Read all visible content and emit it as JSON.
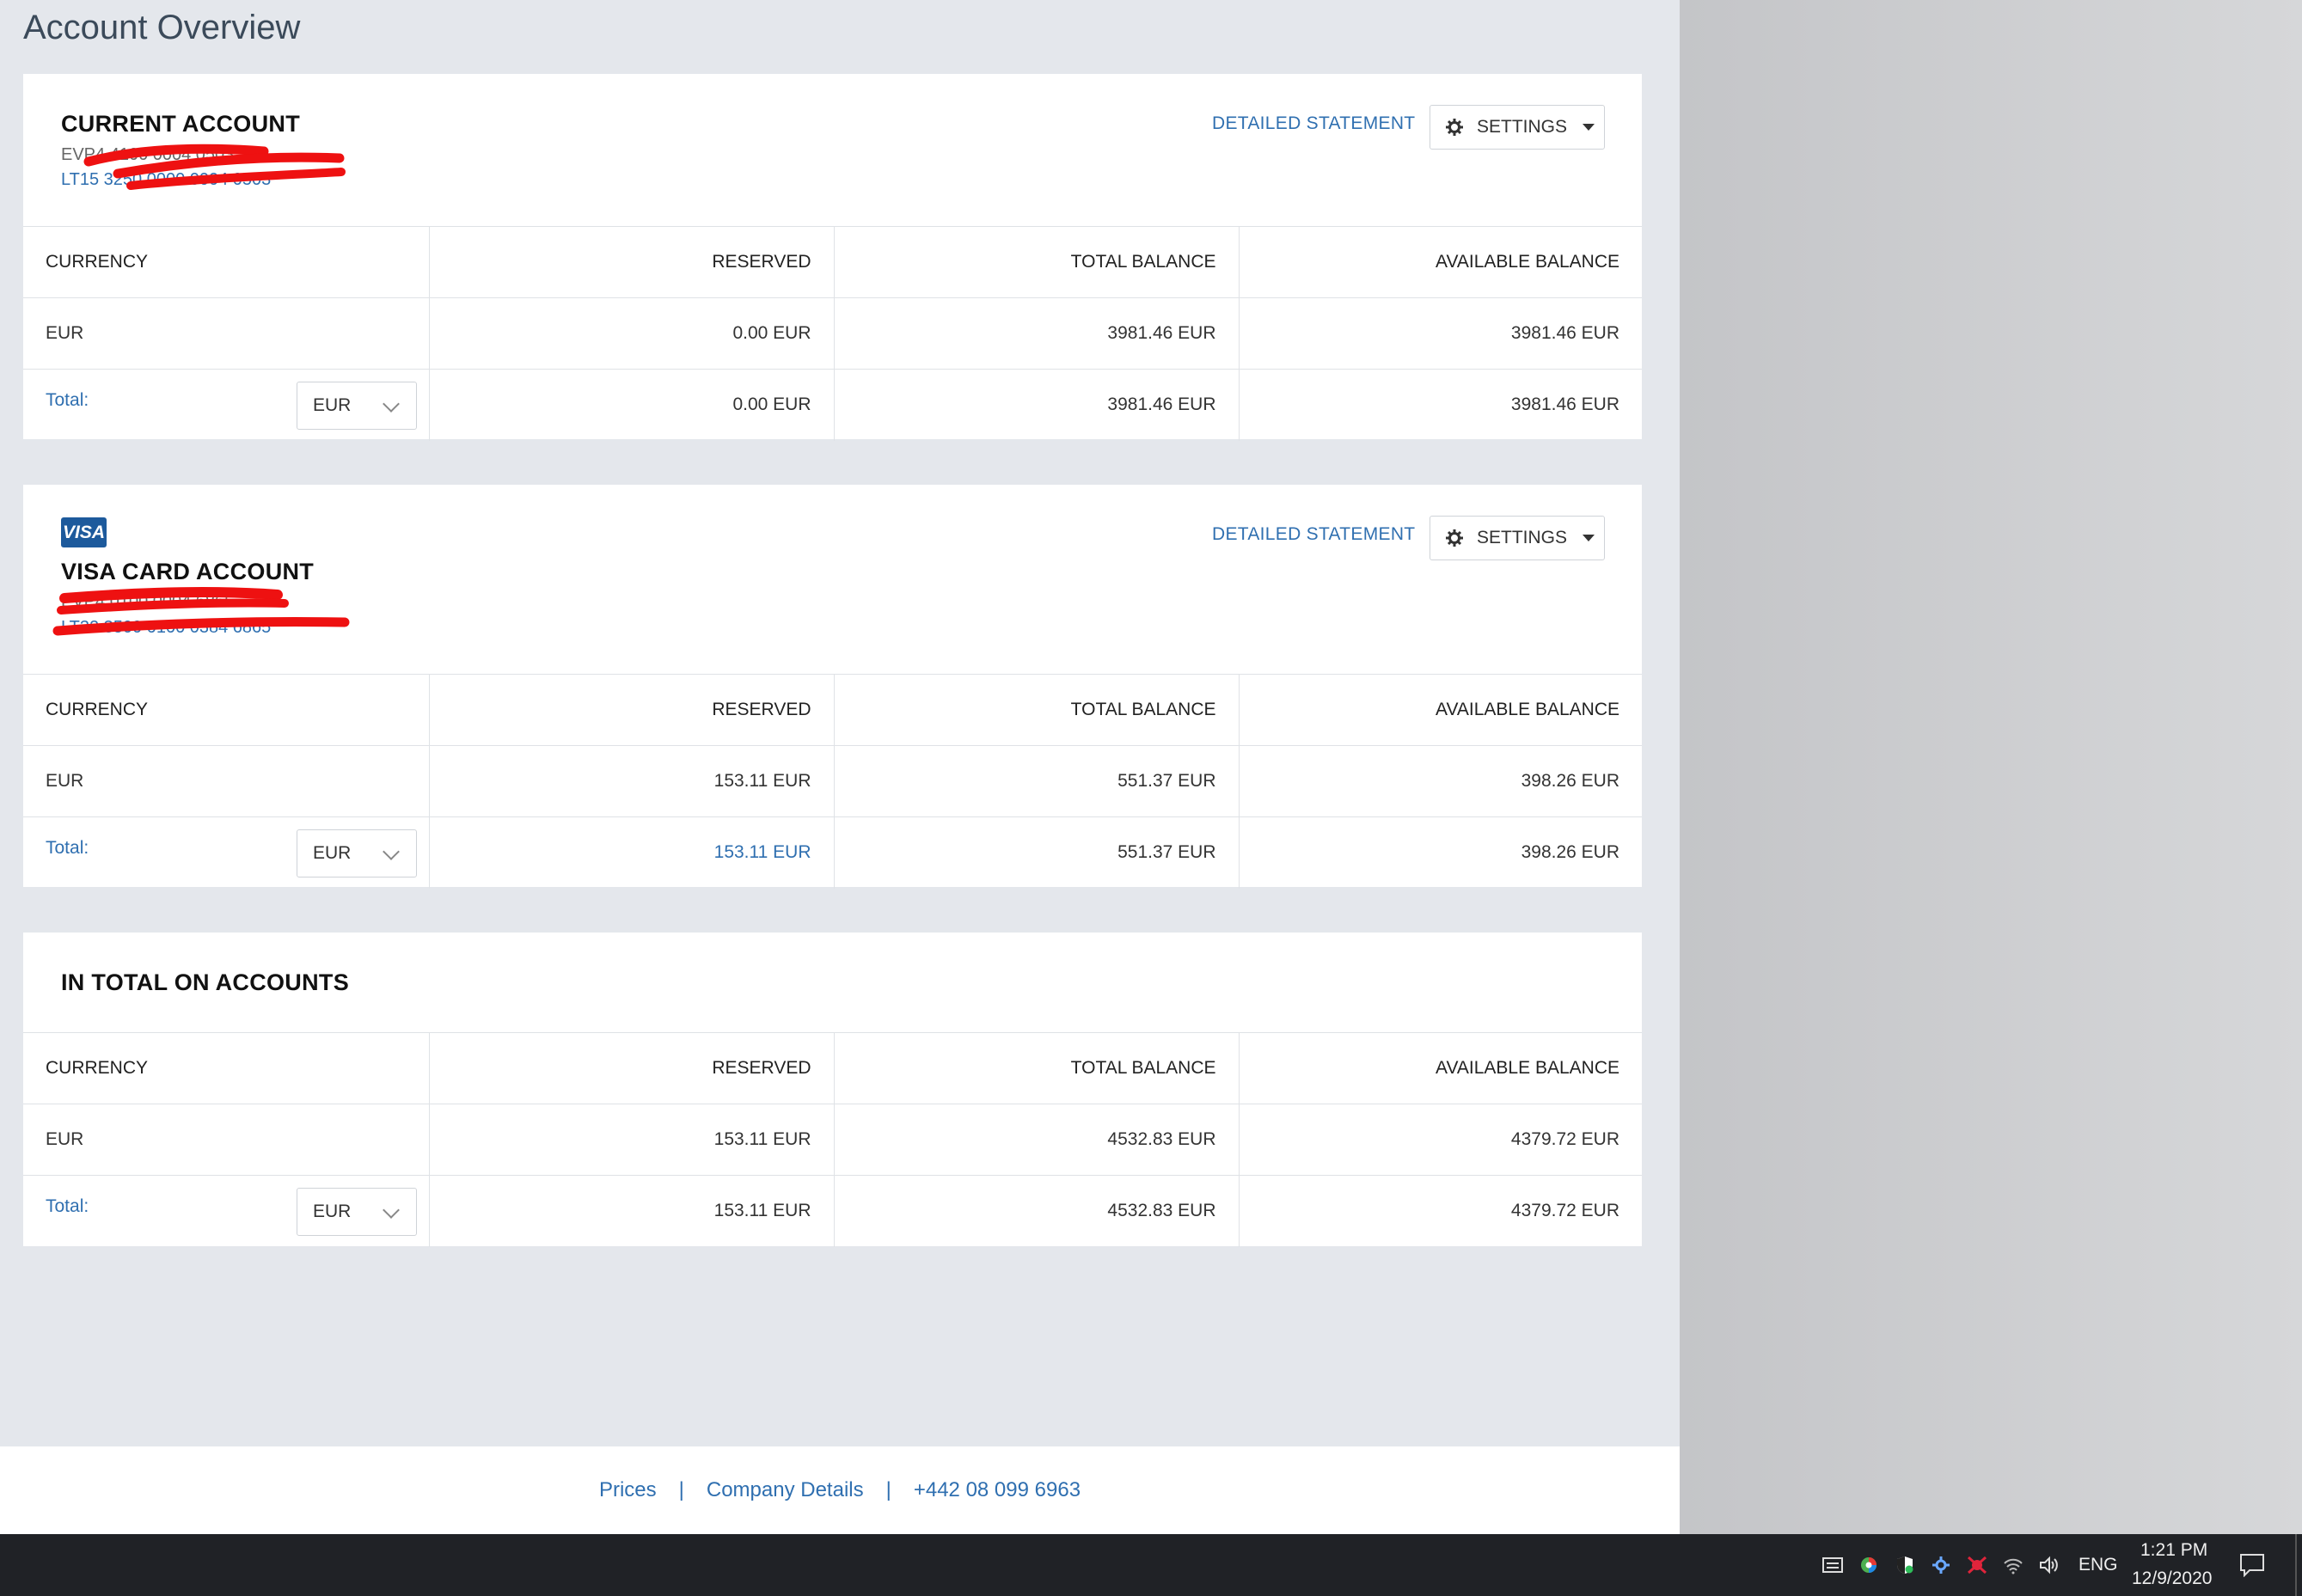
{
  "page": {
    "title": "Account Overview"
  },
  "columns": {
    "currency": "CURRENCY",
    "reserved": "RESERVED",
    "total_balance": "TOTAL BALANCE",
    "available_balance": "AVAILABLE BALANCE"
  },
  "total_label": "Total:",
  "detailed_statement_label": "DETAILED STATEMENT",
  "settings_label": "SETTINGS",
  "current_account": {
    "title": "CURRENT ACCOUNT",
    "number": "EVP4 4100 0004 0503",
    "iban": "LT15 3250 0000 0004 0503",
    "row": {
      "currency": "EUR",
      "reserved": "0.00 EUR",
      "total": "3981.46 EUR",
      "available": "3981.46 EUR"
    },
    "totals": {
      "currency_select": "EUR",
      "reserved": "0.00 EUR",
      "total": "3981.46 EUR",
      "available": "3981.46 EUR"
    }
  },
  "visa_account": {
    "badge": "VISA",
    "title": "VISA CARD ACCOUNT",
    "number": "EVP4 0100 0004 6865",
    "iban": "LT32 3500 0100 0384 6865",
    "row": {
      "currency": "EUR",
      "reserved": "153.11 EUR",
      "total": "551.37 EUR",
      "available": "398.26 EUR"
    },
    "totals": {
      "currency_select": "EUR",
      "reserved": "153.11 EUR",
      "total": "551.37 EUR",
      "available": "398.26 EUR"
    }
  },
  "in_total": {
    "title": "IN TOTAL ON ACCOUNTS",
    "row": {
      "currency": "EUR",
      "reserved": "153.11 EUR",
      "total": "4532.83 EUR",
      "available": "4379.72 EUR"
    },
    "totals": {
      "currency_select": "EUR",
      "reserved": "153.11 EUR",
      "total": "4532.83 EUR",
      "available": "4379.72 EUR"
    }
  },
  "footer": {
    "prices": "Prices",
    "sep": "|",
    "company_details": "Company Details",
    "phone": "+442 08 099 6963"
  },
  "taskbar": {
    "language": "ENG",
    "time": "1:21 PM",
    "date": "12/9/2020"
  },
  "colors": {
    "accent": "#2f6fb0",
    "redaction": "#ee1111",
    "page_bg": "#e4e7ec",
    "taskbar": "#202226"
  }
}
